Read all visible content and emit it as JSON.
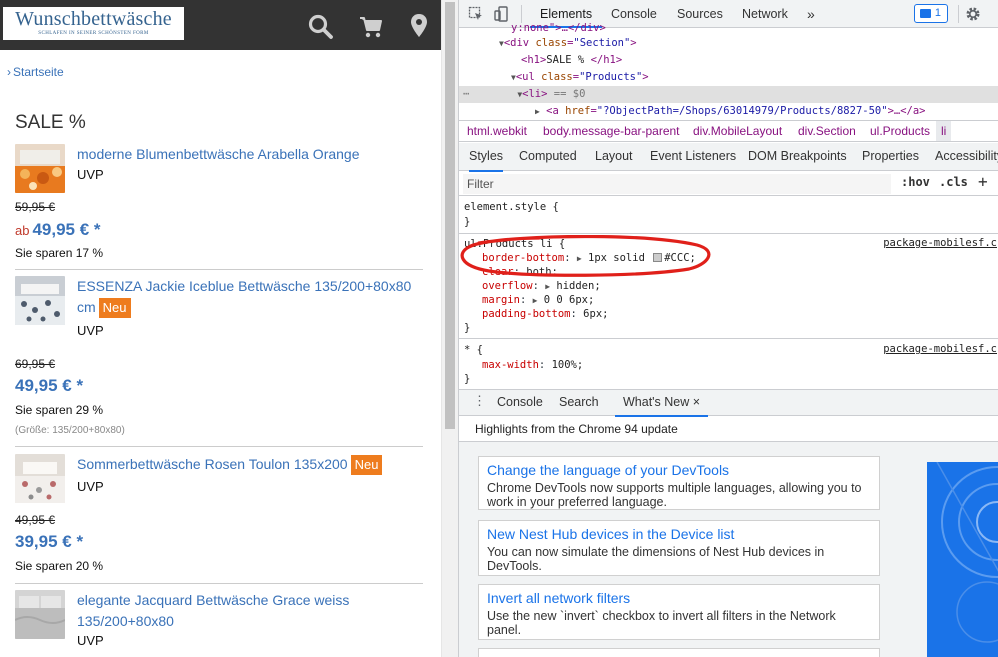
{
  "site": {
    "logo_line1": "Wunschbettwäsche",
    "logo_line2": "SCHLAFEN IN SEINER SCHÖNSTEN FORM",
    "breadcrumb": "Startseite",
    "section_title": "SALE %"
  },
  "products": [
    {
      "name": "moderne Blumenbettwäsche Arabella Orange",
      "badge": "",
      "uvp": "UVP",
      "old_price": "59,95 €",
      "price_prefix": "ab",
      "price": "49,95 € *",
      "savings": "Sie sparen 17 %",
      "size": ""
    },
    {
      "name": "ESSENZA Jackie Iceblue Bettwäsche 135/200+80x80 cm",
      "badge": "Neu",
      "uvp": "UVP",
      "old_price": "69,95 €",
      "price_prefix": "",
      "price": "49,95 € *",
      "savings": "Sie sparen 29 %",
      "size": "(Größe: 135/200+80x80)"
    },
    {
      "name": "Sommerbettwäsche Rosen Toulon 135x200",
      "badge": "Neu",
      "uvp": "UVP",
      "old_price": "49,95 €",
      "price_prefix": "",
      "price": "39,95 € *",
      "savings": "Sie sparen 20 %",
      "size": ""
    },
    {
      "name": "elegante Jacquard Bettwäsche Grace weiss 135/200+80x80",
      "badge": "",
      "uvp": "UVP",
      "old_price": "",
      "price_prefix": "",
      "price": "",
      "savings": "",
      "size": ""
    }
  ],
  "devtools": {
    "tabs": [
      "Elements",
      "Console",
      "Sources",
      "Network"
    ],
    "more_tabs": "»",
    "message_count": "1",
    "dom": {
      "line0": "y:none\">…</div>",
      "line1_tag": "<div",
      "line1_attr": "class",
      "line1_val": "\"Section\"",
      "line2_h1_open": "<h1>",
      "line2_text": "SALE % ",
      "line2_h1_close": "</h1>",
      "line3_tag": "<ul",
      "line3_attr": "class",
      "line3_val": "\"Products\"",
      "line4_tag": "<li>",
      "line4_marker": "== $0",
      "line5_tag": "<a",
      "line5_attr": "href",
      "line5_val": "\"?ObjectPath=/Shops/63014979/Products/8827-50\"",
      "line5_end": ">…</a>"
    },
    "breadcrumbs": [
      "html.webkit",
      "body.message-bar-parent",
      "div.MobileLayout",
      "div.Section",
      "ul.Products",
      "li"
    ],
    "styles_tabs": [
      "Styles",
      "Computed",
      "Layout",
      "Event Listeners",
      "DOM Breakpoints",
      "Properties",
      "Accessibility"
    ],
    "filter_placeholder": "Filter",
    "hov": ":hov",
    "cls": ".cls",
    "plus": "+",
    "element_style": "element.style {",
    "close_brace": "}",
    "rule1": {
      "selector": "ul.Products li {",
      "source": "package-mobilesf.c",
      "props": [
        {
          "name": "border-bottom",
          "value": "1px solid",
          "color": "#CCC;",
          "arrow": true,
          "swatch": true
        },
        {
          "name": "clear",
          "value": "both;",
          "arrow": false,
          "swatch": false
        },
        {
          "name": "overflow",
          "value": "hidden;",
          "arrow": true,
          "swatch": false
        },
        {
          "name": "margin",
          "value": "0 0 6px;",
          "arrow": true,
          "swatch": false
        },
        {
          "name": "padding-bottom",
          "value": "6px;",
          "arrow": false,
          "swatch": false
        }
      ]
    },
    "rule2": {
      "selector": "* {",
      "source": "package-mobilesf.c",
      "prop": "max-width",
      "value": "100%;"
    },
    "drawer_tabs": [
      "Console",
      "Search",
      "What's New"
    ],
    "drawer_close": "×",
    "whatsnew_header": "Highlights from the Chrome 94 update",
    "cards": [
      {
        "title": "Change the language of your DevTools",
        "body": "Chrome DevTools now supports multiple languages, allowing you to work in your preferred language."
      },
      {
        "title": "New Nest Hub devices in the Device list",
        "body": "You can now simulate the dimensions of Nest Hub devices in DevTools."
      },
      {
        "title": "Invert all network filters",
        "body": "Use the new `invert` checkbox to invert all filters in the Network panel."
      }
    ],
    "colors": {
      "accent": "#1a73e8",
      "highlight_circle": "#e0201a",
      "badge_orange": "#ee7c1e",
      "link_blue": "#3a72b8"
    }
  }
}
